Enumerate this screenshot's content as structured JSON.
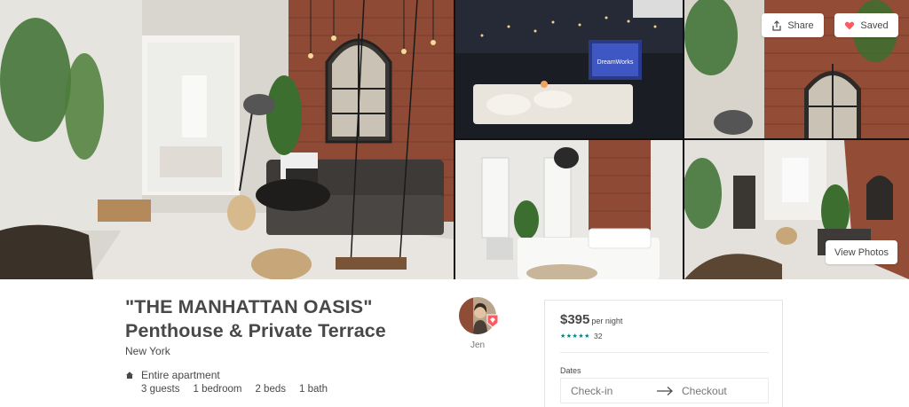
{
  "gallery": {
    "share_label": "Share",
    "saved_label": "Saved",
    "view_photos_label": "View Photos",
    "screen_text": "DreamWorks"
  },
  "listing": {
    "title_line1": "\"THE MANHATTAN OASIS\"",
    "title_line2": "Penthouse & Private Terrace",
    "location": "New York",
    "type": "Entire apartment",
    "guests": "3 guests",
    "bedrooms": "1 bedroom",
    "beds": "2 beds",
    "baths": "1 bath"
  },
  "host": {
    "name": "Jen"
  },
  "booking": {
    "price": "$395",
    "per_night": "per night",
    "stars": "★★★★★",
    "rating": 5,
    "review_count": "32",
    "dates_label": "Dates",
    "checkin_placeholder": "Check-in",
    "checkout_placeholder": "Checkout"
  },
  "colors": {
    "text": "#484848",
    "muted": "#767676",
    "accent_teal": "#008489",
    "brand": "#FF5A5F",
    "border": "#E4E4E4"
  }
}
